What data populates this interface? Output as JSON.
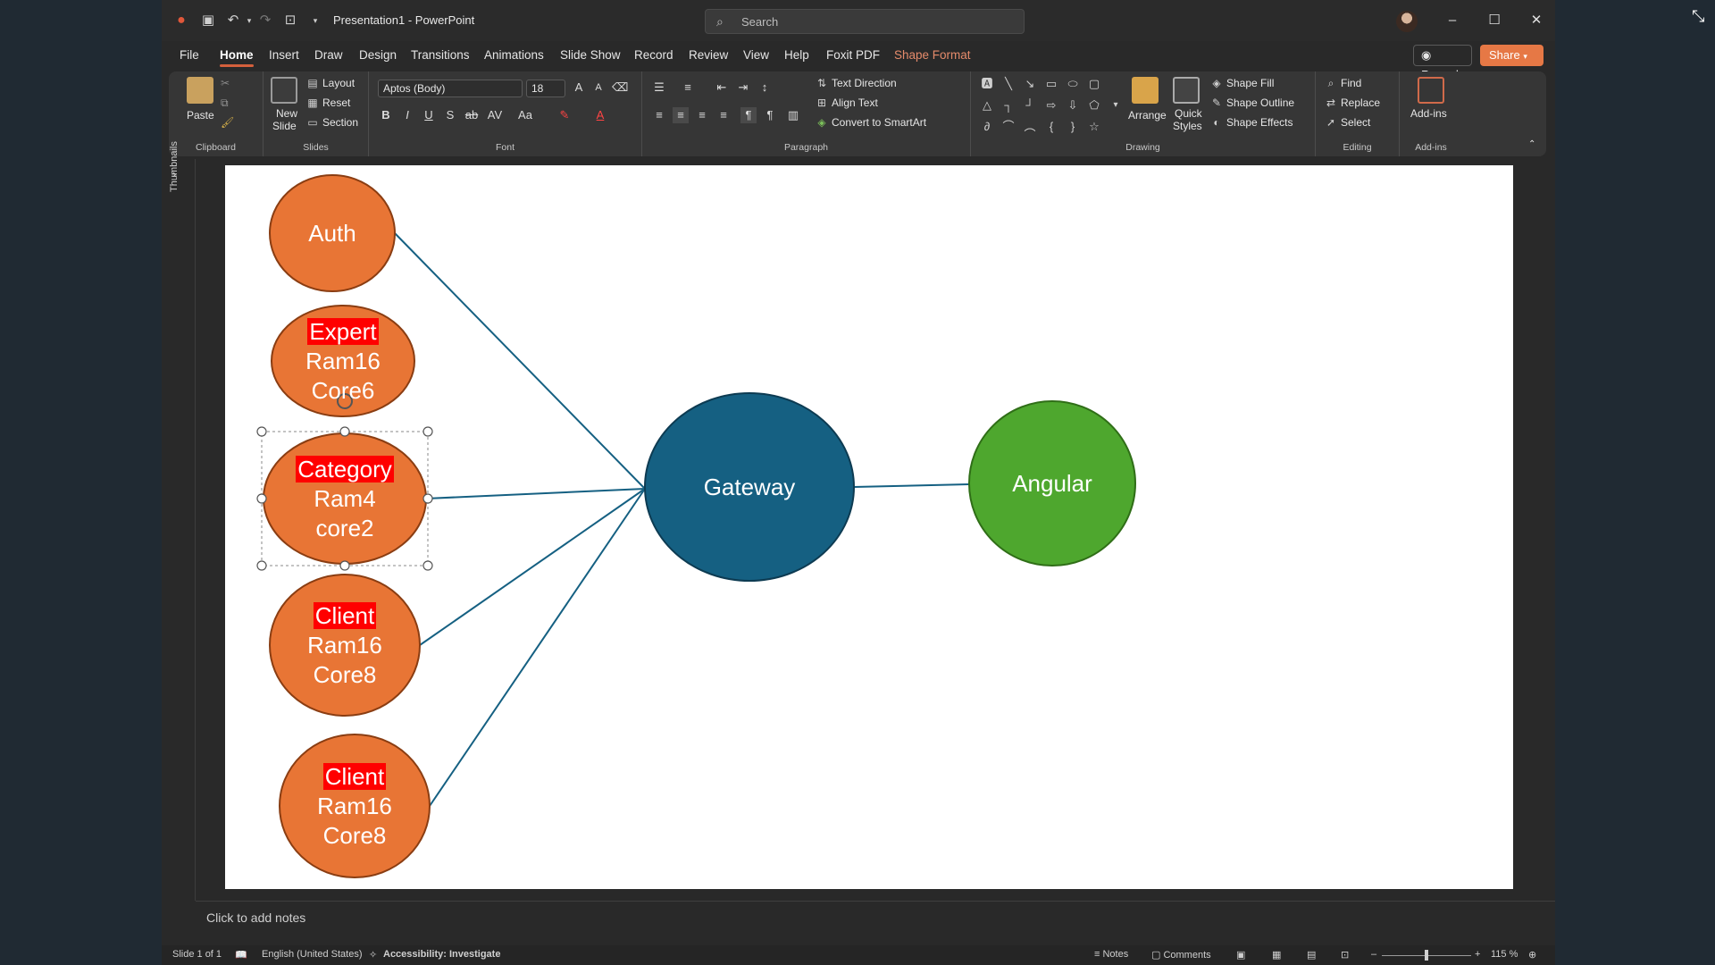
{
  "window": {
    "title": "Presentation1  -  PowerPoint",
    "search_placeholder": "Search"
  },
  "menu": {
    "tabs": [
      "File",
      "Home",
      "Insert",
      "Draw",
      "Design",
      "Transitions",
      "Animations",
      "Slide Show",
      "Record",
      "Review",
      "View",
      "Help",
      "Foxit PDF",
      "Shape Format"
    ],
    "active_tab": "Home",
    "record_label": "Record",
    "share_label": "Share"
  },
  "ribbon": {
    "clipboard": {
      "label": "Clipboard",
      "paste": "Paste"
    },
    "slides": {
      "label": "Slides",
      "new_slide_line1": "New",
      "new_slide_line2": "Slide",
      "layout": "Layout",
      "reset": "Reset",
      "section": "Section"
    },
    "font": {
      "label": "Font",
      "family": "Aptos (Body)",
      "size": "18"
    },
    "paragraph": {
      "label": "Paragraph",
      "text_direction": "Text Direction",
      "align_text": "Align Text",
      "convert_smartart": "Convert to SmartArt"
    },
    "drawing": {
      "label": "Drawing",
      "arrange": "Arrange",
      "quick_styles_line1": "Quick",
      "quick_styles_line2": "Styles",
      "shape_fill": "Shape Fill",
      "shape_outline": "Shape Outline",
      "shape_effects": "Shape Effects"
    },
    "editing": {
      "label": "Editing",
      "find": "Find",
      "replace": "Replace",
      "select": "Select"
    },
    "addins": {
      "label": "Add-ins",
      "button": "Add-ins"
    }
  },
  "thumbnails_label": "Thumbnails",
  "slide": {
    "nodes": [
      {
        "id": "auth",
        "lines": [
          "Auth"
        ],
        "highlight_first": false,
        "color": "#e87535"
      },
      {
        "id": "expert",
        "lines": [
          "Expert",
          "Ram16",
          "Core6"
        ],
        "highlight_first": true,
        "color": "#e87535"
      },
      {
        "id": "category",
        "lines": [
          "Category",
          "Ram4",
          "core2"
        ],
        "highlight_first": true,
        "color": "#e87535"
      },
      {
        "id": "client1",
        "lines": [
          "Client",
          "Ram16",
          "Core8"
        ],
        "highlight_first": true,
        "color": "#e87535"
      },
      {
        "id": "client2",
        "lines": [
          "Client",
          "Ram16",
          "Core8"
        ],
        "highlight_first": true,
        "color": "#e87535"
      },
      {
        "id": "gateway",
        "lines": [
          "Gateway"
        ],
        "highlight_first": false,
        "color": "#156082"
      },
      {
        "id": "angular",
        "lines": [
          "Angular"
        ],
        "highlight_first": false,
        "color": "#4ea72e"
      }
    ],
    "connector_color": "#156082",
    "highlight_color": "#ff0000"
  },
  "notes_placeholder": "Click to add notes",
  "status": {
    "slide": "Slide 1 of 1",
    "language": "English (United States)",
    "accessibility": "Accessibility: Investigate",
    "notes": "Notes",
    "comments": "Comments",
    "zoom": "115 %"
  }
}
